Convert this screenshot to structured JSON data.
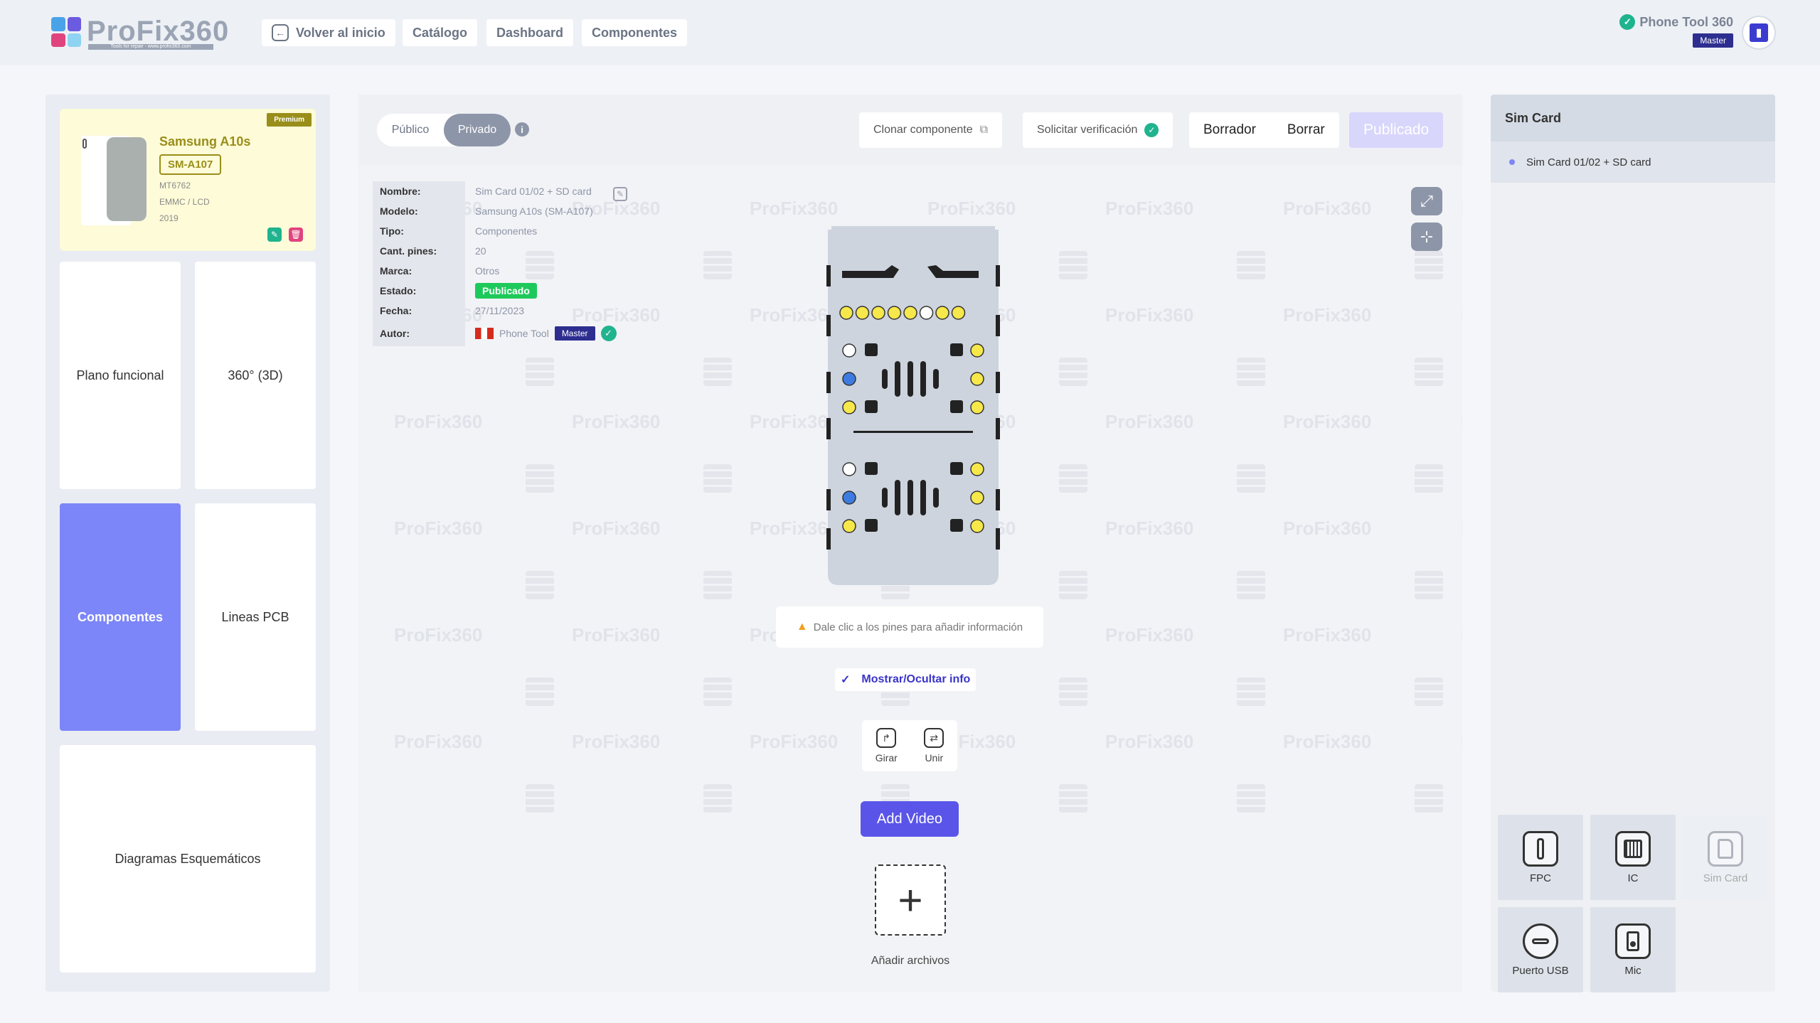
{
  "brand": {
    "name": "ProFix360",
    "tagline": "Tools for repair - www.profix360.com"
  },
  "nav": {
    "back": "Volver al inicio",
    "catalog": "Catálogo",
    "dashboard": "Dashboard",
    "components": "Componentes"
  },
  "user": {
    "name": "Phone Tool 360",
    "role": "Master"
  },
  "device": {
    "badge": "Premium",
    "name": "Samsung A10s",
    "model": "SM-A107",
    "chip": "MT6762",
    "storage": "EMMC / LCD",
    "year": "2019"
  },
  "tiles": {
    "plano": "Plano funcional",
    "tres60": "360° (3D)",
    "componentes": "Componentes",
    "lineas": "Lineas PCB",
    "diagramas": "Diagramas Esquemáticos"
  },
  "toolbar": {
    "public": "Público",
    "private": "Privado",
    "clone": "Clonar componente",
    "verify": "Solicitar verificación",
    "draft": "Borrador",
    "delete": "Borrar",
    "published": "Publicado"
  },
  "watermark": "ProFix360",
  "info": {
    "labels": {
      "name": "Nombre:",
      "model": "Modelo:",
      "type": "Tipo:",
      "pins": "Cant. pines:",
      "brand": "Marca:",
      "status": "Estado:",
      "date": "Fecha:",
      "author": "Autor:"
    },
    "values": {
      "name": "Sim Card 01/02 + SD card",
      "model": "Samsung A10s (SM-A107)",
      "type": "Componentes",
      "pins": "20",
      "brand": "Otros",
      "status": "Publicado",
      "date": "27/11/2023",
      "author": "Phone Tool",
      "author_role": "Master"
    }
  },
  "canvas": {
    "hint": "Dale clic a los pines para añadir información",
    "toggle_info": "Mostrar/Ocultar info",
    "rotate": "Girar",
    "join": "Unir",
    "add_video": "Add Video",
    "add_files": "Añadir archivos"
  },
  "right": {
    "title": "Sim Card",
    "item": "Sim Card 01/02 + SD card",
    "components": {
      "fpc": "FPC",
      "ic": "IC",
      "sim": "Sim Card",
      "usb": "Puerto USB",
      "mic": "Mic"
    }
  },
  "colors": {
    "accent": "#5a55e8",
    "tile_active": "#7c86f8",
    "published": "#1ec95b",
    "premium": "#9a8e1a",
    "pin_yellow": "#f6e84a",
    "pin_blue": "#3d7be0"
  }
}
